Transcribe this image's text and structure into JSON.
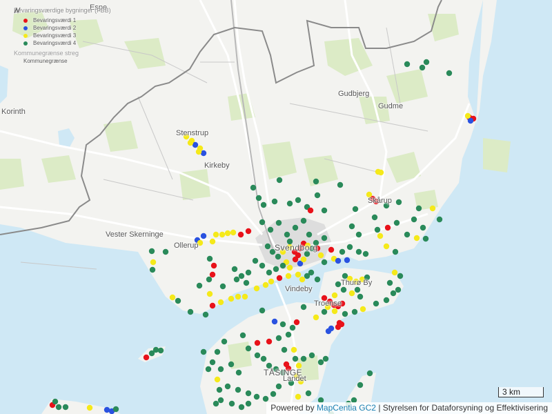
{
  "legend": {
    "title": "Bevaringsværdige bygninger (FBB)",
    "items": [
      {
        "label": "Bevaringsværdi 1",
        "color": "#e8121a"
      },
      {
        "label": "Bevaringsværdi 2",
        "color": "#2a52e0"
      },
      {
        "label": "Bevaringsværdi 3",
        "color": "#f5e91a"
      },
      {
        "label": "Bevaringsværdi 4",
        "color": "#2a8a5a"
      }
    ],
    "boundary_title": "Kommunegrænse streg",
    "boundary_label": "Kommunegrænse"
  },
  "places": {
    "espe": "Espe",
    "korinth": "Korinth",
    "gudbjerg": "Gudbjerg",
    "gudme": "Gudme",
    "stenstrup": "Stenstrup",
    "kirkeby": "Kirkeby",
    "vester_skerninge": "Vester Skerninge",
    "ollerup": "Ollerup",
    "svendborg": "Svendborg",
    "skarup": "Skårup",
    "vindeby": "Vindeby",
    "troense": "Troense",
    "thuro_by": "Thurø By",
    "tasinge": "TÅSINGE",
    "landet": "Landet"
  },
  "scale_label": "3 km",
  "attribution": {
    "prefix": "Powered by ",
    "link": "MapCentia GC2",
    "suffix": " | Styrelsen for Dataforsyning og Effektivisering"
  },
  "colors": {
    "water": "#cfe8f5",
    "land": "#f4f4f1",
    "forest": "#dcebc6",
    "boundary": "#8a8a8a",
    "road": "#ffffff"
  }
}
